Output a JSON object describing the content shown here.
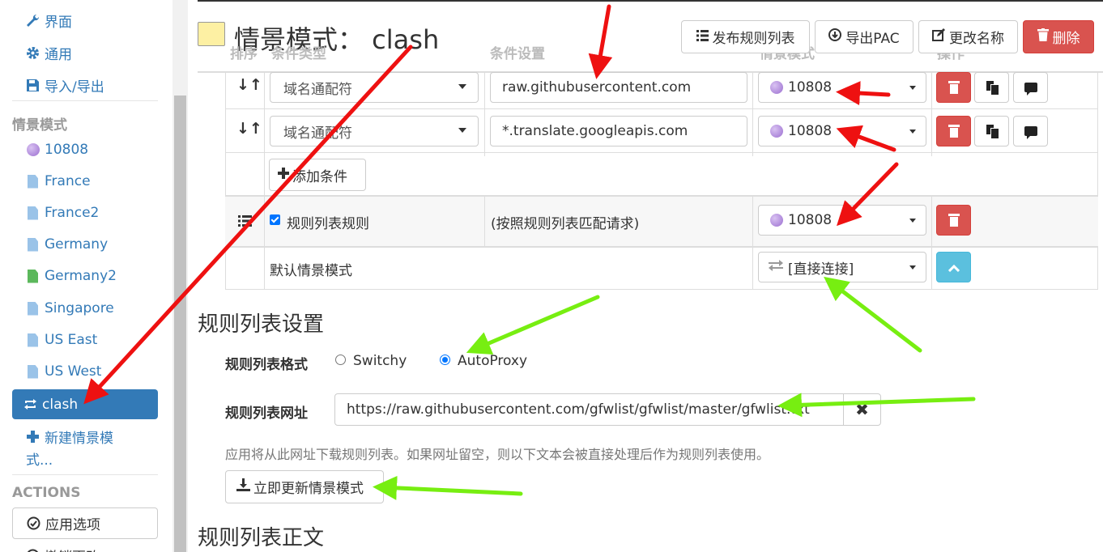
{
  "sidebar": {
    "top_items": [
      {
        "label": "界面",
        "icon": "wrench-icon"
      },
      {
        "label": "通用",
        "icon": "gear-icon"
      },
      {
        "label": "导入/导出",
        "icon": "floppy-icon"
      }
    ],
    "profiles_header": "情景模式",
    "profiles": [
      {
        "label": "10808",
        "icon": "globe-icon"
      },
      {
        "label": "France",
        "icon": "file-icon"
      },
      {
        "label": "France2",
        "icon": "file-icon"
      },
      {
        "label": "Germany",
        "icon": "file-icon"
      },
      {
        "label": "Germany2",
        "icon": "file-icon-green"
      },
      {
        "label": "Singapore",
        "icon": "file-icon"
      },
      {
        "label": "US East",
        "icon": "file-icon"
      },
      {
        "label": "US West",
        "icon": "file-icon"
      }
    ],
    "active_profile": "clash",
    "new_profile_label_line1": "新建情景模",
    "new_profile_label_line2": "式...",
    "actions_header": "ACTIONS",
    "apply_options": "应用选项",
    "cut_off_item": "撤销更改"
  },
  "header": {
    "title": "情景模式：   clash",
    "swatch_color": "#fdf0a3",
    "publish_label": "发布规则列表",
    "export_pac_label": "导出PAC",
    "rename_label": "更改名称",
    "delete_label": "删除"
  },
  "table": {
    "col_sort": "排序",
    "col_condition_type": "条件类型",
    "col_condition": "条件设置",
    "col_profile": "情景模式",
    "col_actions": "操作",
    "rows": [
      {
        "type": "域名通配符",
        "condition": "raw.githubusercontent.com",
        "profile": "10808"
      },
      {
        "type": "域名通配符",
        "condition": "*.translate.googleapis.com",
        "profile": "10808"
      }
    ],
    "add_condition": "添加条件",
    "rulelist_rule_label": "规则列表规则",
    "rulelist_rule_desc": "(按照规则列表匹配请求)",
    "rulelist_rule_profile": "10808",
    "default_label": "默认情景模式",
    "default_profile": "[直接连接]"
  },
  "rulelist_settings": {
    "heading": "规则列表设置",
    "format_label": "规则列表格式",
    "format_options": [
      "Switchy",
      "AutoProxy"
    ],
    "format_selected": "AutoProxy",
    "url_label": "规则列表网址",
    "url_value": "https://raw.githubusercontent.com/gfwlist/gfwlist/master/gfwlist.txt",
    "help_text": "应用将从此网址下载规则列表。如果网址留空，则以下文本会被直接处理后作为规则列表使用。",
    "update_button": "立即更新情景模式"
  },
  "rulelist_body": {
    "heading": "规则列表正文"
  },
  "colors": {
    "primary": "#337ab7",
    "danger": "#d9534f",
    "info": "#5bc0de",
    "annotation_red": "#ee1111",
    "annotation_green": "#77ee11"
  }
}
